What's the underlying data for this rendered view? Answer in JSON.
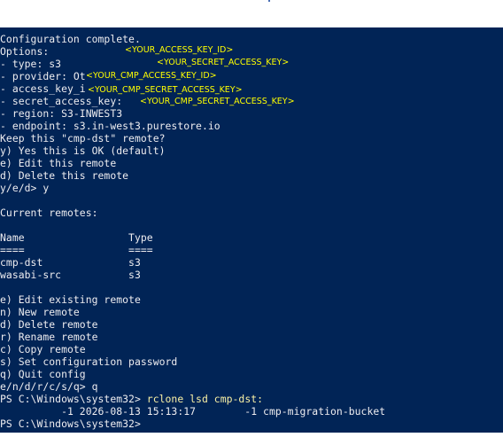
{
  "terminal": {
    "lines": [
      {
        "text": "Configuration complete."
      },
      {
        "text": "Options:"
      },
      {
        "text": "- type: s3"
      },
      {
        "text": "- provider: Ot"
      },
      {
        "text": "- access_key_i"
      },
      {
        "text": "- secret_access_key:"
      },
      {
        "text": "- region: S3-INWEST3"
      },
      {
        "text": "- endpoint: s3.in-west3.purestore.io"
      },
      {
        "text": "Keep this \"cmp-dst\" remote?"
      },
      {
        "text": "y) Yes this is OK (default)"
      },
      {
        "text": "e) Edit this remote"
      },
      {
        "text": "d) Delete this remote"
      },
      {
        "text": "y/e/d> y"
      },
      {
        "text": ""
      },
      {
        "text": "Current remotes:"
      },
      {
        "text": ""
      },
      {
        "text": "Name                 Type"
      },
      {
        "text": "====                 ===="
      },
      {
        "text": "cmp-dst              s3"
      },
      {
        "text": "wasabi-src           s3"
      },
      {
        "text": ""
      },
      {
        "text": "e) Edit existing remote"
      },
      {
        "text": "n) New remote"
      },
      {
        "text": "d) Delete remote"
      },
      {
        "text": "r) Rename remote"
      },
      {
        "text": "c) Copy remote"
      },
      {
        "text": "s) Set configuration password"
      },
      {
        "text": "q) Quit config"
      },
      {
        "text": "e/n/d/r/c/s/q> q"
      },
      {
        "text": "PS C:\\Windows\\system32> ",
        "cmd": "rclone lsd cmp-dst:"
      },
      {
        "text": "          -1 2026-08-13 15:13:17        -1 cmp-migration-bucket"
      },
      {
        "text": "PS C:\\Windows\\system32>"
      }
    ],
    "redactions": [
      {
        "text": "<YOUR_ACCESS_KEY_ID>"
      },
      {
        "text": "<YOUR_SECRET_ACCESS_KEY>"
      },
      {
        "text": "<YOUR_CMP_ACCESS_KEY_ID>"
      },
      {
        "text": "<YOUR_CMP_SECRET_ACCESS_KEY>"
      },
      {
        "text": "<YOUR_CMP_SECRET_ACCESS_KEY>"
      }
    ]
  }
}
